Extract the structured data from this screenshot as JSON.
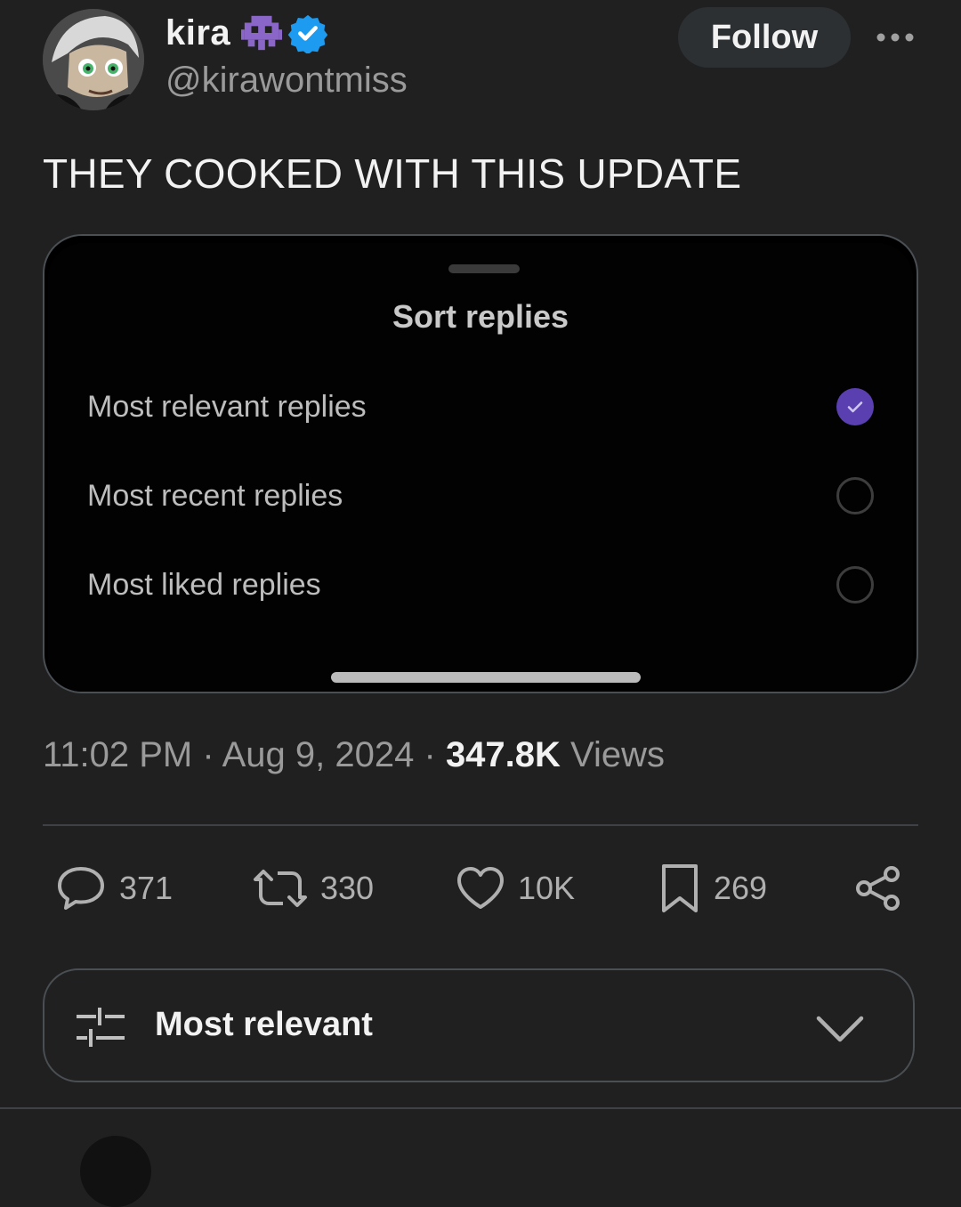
{
  "author": {
    "display_name": "kira",
    "handle": "@kirawontmiss",
    "verified": true
  },
  "header": {
    "follow_label": "Follow"
  },
  "tweet": {
    "text": "THEY COOKED WITH THIS UPDATE",
    "time": "11:02 PM",
    "separator": "·",
    "date": "Aug 9, 2024",
    "views_count": "347.8K",
    "views_label": "Views"
  },
  "media": {
    "sheet_title": "Sort replies",
    "options": [
      {
        "label": "Most relevant replies",
        "selected": true
      },
      {
        "label": "Most recent replies",
        "selected": false
      },
      {
        "label": "Most liked replies",
        "selected": false
      }
    ]
  },
  "actions": {
    "replies": "371",
    "reposts": "330",
    "likes": "10K",
    "bookmarks": "269"
  },
  "reply_sort": {
    "label": "Most relevant"
  },
  "colors": {
    "background": "#202020",
    "accent_check": "#5a3fb0",
    "verified_blue": "#1d9bf0",
    "alien_purple": "#8a66c9"
  },
  "icons": [
    "alien-monster-icon",
    "verified-badge-icon",
    "more-icon",
    "reply-icon",
    "repost-icon",
    "like-icon",
    "bookmark-icon",
    "share-icon",
    "sliders-icon",
    "chevron-down-icon",
    "check-icon"
  ]
}
